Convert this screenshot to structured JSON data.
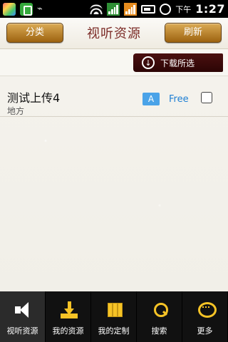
{
  "status_bar": {
    "ampm": "下午",
    "time": "1:27"
  },
  "header": {
    "left_button": "分类",
    "title": "视听资源",
    "right_button": "刷新"
  },
  "download_bar": {
    "button_label": "下载所选"
  },
  "list": {
    "items": [
      {
        "title": "测试上传4",
        "subtitle": "地方",
        "badge": "A",
        "price": "Free",
        "selected": false
      }
    ]
  },
  "bottom_nav": {
    "items": [
      {
        "label": "视听资源",
        "icon": "speaker-icon",
        "active": true
      },
      {
        "label": "我的资源",
        "icon": "download-icon",
        "active": false
      },
      {
        "label": "我的定制",
        "icon": "book-icon",
        "active": false
      },
      {
        "label": "搜索",
        "icon": "search-icon",
        "active": false
      },
      {
        "label": "更多",
        "icon": "more-icon",
        "active": false
      }
    ]
  }
}
